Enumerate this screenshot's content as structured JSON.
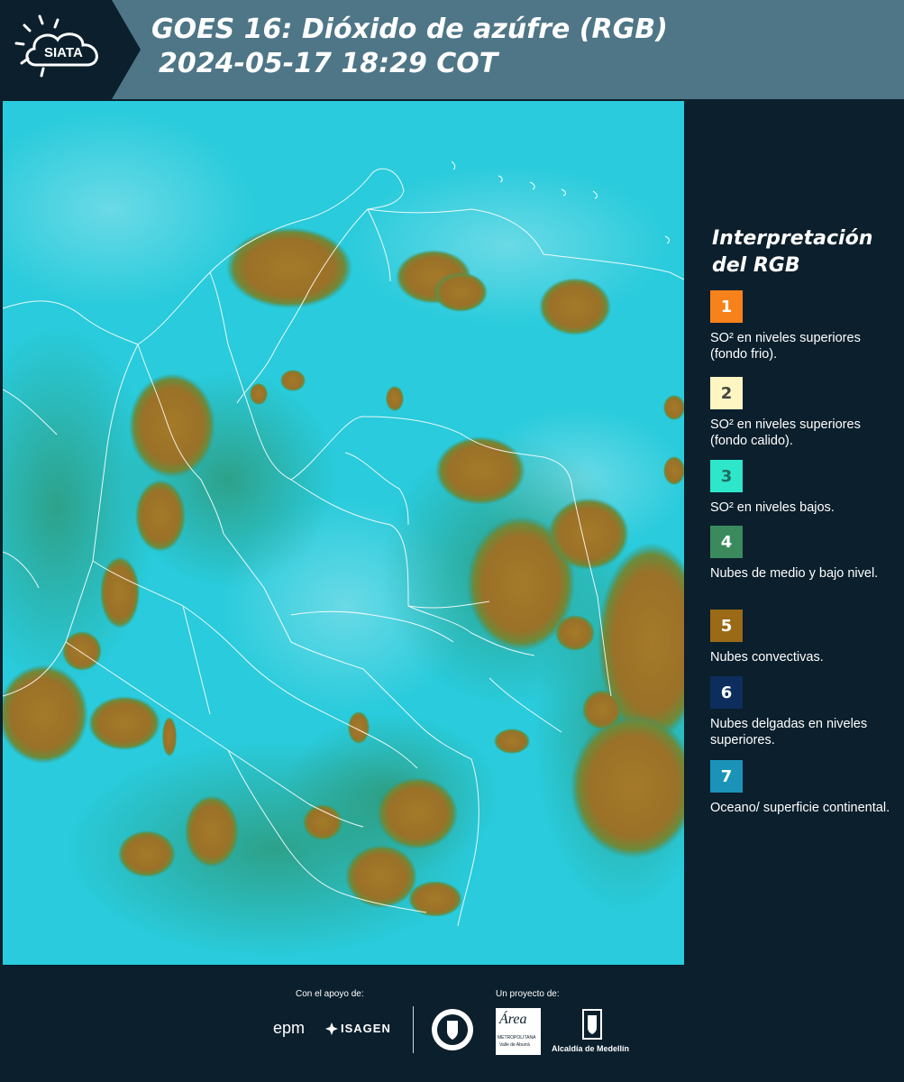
{
  "header": {
    "logo_text": "SIATA",
    "title": "GOES 16: Dióxido de azúfre (RGB)",
    "subtitle": "2024-05-17 18:29 COT"
  },
  "legend": {
    "title_line1": "Interpretación",
    "title_line2": "del RGB",
    "items": [
      {
        "number": "1",
        "label": "SO² en niveles superiores (fondo frio).",
        "color": "#f7821b",
        "text_color": "#ffffff"
      },
      {
        "number": "2",
        "label": "SO² en niveles superiores (fondo calido).",
        "color": "#fdf6c3",
        "text_color": "#444444"
      },
      {
        "number": "3",
        "label": "SO² en niveles bajos.",
        "color": "#2ee6c9",
        "text_color": "#1d6e62"
      },
      {
        "number": "4",
        "label": "Nubes de medio y bajo nivel.",
        "color": "#3a8a5e",
        "text_color": "#ffffff"
      },
      {
        "number": "5",
        "label": "Nubes convectivas.",
        "color": "#9a6a16",
        "text_color": "#ffffff"
      },
      {
        "number": "6",
        "label": "Nubes delgadas en niveles superiores.",
        "color": "#0d2e5c",
        "text_color": "#ffffff"
      },
      {
        "number": "7",
        "label": "Oceano/ superficie continental.",
        "color": "#1b93b8",
        "text_color": "#ffffff"
      }
    ]
  },
  "footer": {
    "support_label": "Con el apoyo de:",
    "project_label": "Un proyecto de:",
    "brand_epm": "epm",
    "brand_isagen": "ISAGEN",
    "brand_area_name": "Área",
    "brand_area_sub": "METROPOLITANA",
    "brand_area_sub2": "Valle de Aburrá",
    "brand_alcaldia": "Alcaldía de Medellín"
  },
  "colors": {
    "header_bg": "#4e7687",
    "logo_bg": "#0b1f2c",
    "page_bg": "#0b1f2c",
    "sky": "#29cbdc",
    "cloud": "#a1782a"
  }
}
